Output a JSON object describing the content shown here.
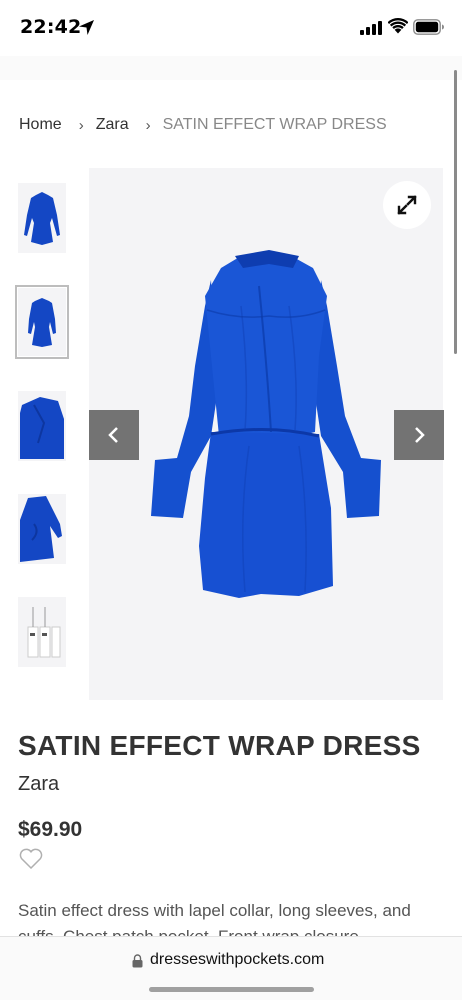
{
  "status_bar": {
    "time": "22:42",
    "icons": [
      "location-arrow-icon",
      "cellular-signal-icon",
      "wifi-icon",
      "battery-icon"
    ]
  },
  "breadcrumb": {
    "items": [
      "Home",
      "Zara",
      "SATIN EFFECT WRAP DRESS"
    ],
    "separator": "›"
  },
  "gallery": {
    "thumbnails": [
      "dress front",
      "dress front model",
      "dress detail",
      "dress side",
      "dress label"
    ],
    "active_thumbnail": 2,
    "buttons": [
      "expand-icon",
      "previous-arrow-icon",
      "next-arrow-icon"
    ],
    "dress_color": "#1447c4"
  },
  "product": {
    "title": "SATIN EFFECT WRAP DRESS",
    "brand": "Zara",
    "price": "$69.90",
    "description": "Satin effect dress with lapel collar, long sleeves, and cuffs. Chest patch pocket. Front wrap closure"
  },
  "browser": {
    "url": "dresseswithpockets.com"
  }
}
